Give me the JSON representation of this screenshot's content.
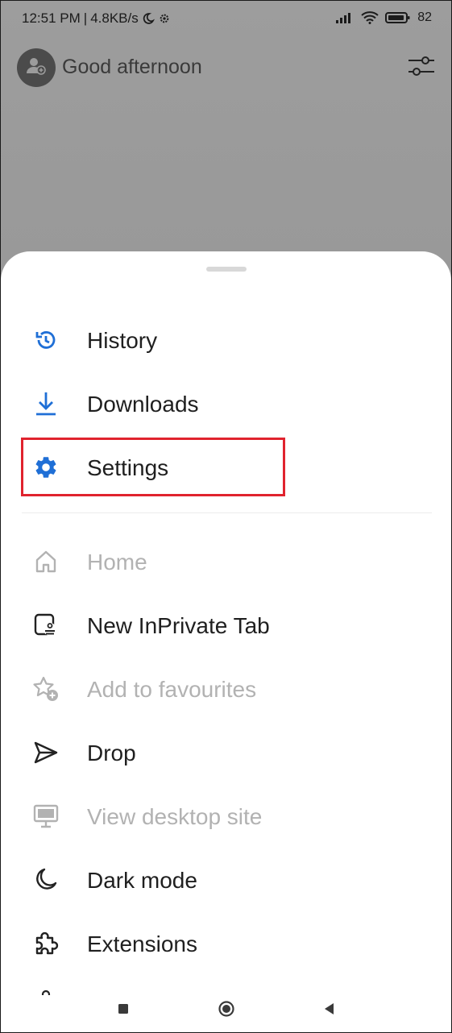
{
  "status_bar": {
    "time": "12:51 PM",
    "separator": "|",
    "speed": "4.8KB/s",
    "icons": [
      "moon-icon",
      "settings-gear-icon",
      "signal-icon",
      "wifi-icon",
      "battery-icon"
    ],
    "battery_percent": "82"
  },
  "header": {
    "greeting": "Good afternoon",
    "avatar_icon": "add-profile-icon",
    "customize_icon": "tune-sliders-icon"
  },
  "menu": {
    "primary": [
      {
        "label": "History",
        "icon": "history-icon",
        "color": "#1f6fd6",
        "enabled": true
      },
      {
        "label": "Downloads",
        "icon": "download-icon",
        "color": "#1f6fd6",
        "enabled": true
      },
      {
        "label": "Settings",
        "icon": "gear-icon",
        "color": "#1f6fd6",
        "enabled": true,
        "highlighted": true
      }
    ],
    "secondary": [
      {
        "label": "Home",
        "icon": "home-icon",
        "enabled": false
      },
      {
        "label": "New InPrivate Tab",
        "icon": "inprivate-tab-icon",
        "enabled": true
      },
      {
        "label": "Add to favourites",
        "icon": "add-favourite-icon",
        "enabled": false
      },
      {
        "label": "Drop",
        "icon": "send-icon",
        "enabled": true
      },
      {
        "label": "View desktop site",
        "icon": "desktop-icon",
        "enabled": false
      },
      {
        "label": "Dark mode",
        "icon": "moon-icon",
        "enabled": true
      },
      {
        "label": "Extensions",
        "icon": "puzzle-icon",
        "enabled": true
      }
    ]
  },
  "colors": {
    "accent": "#1f6fd6",
    "highlight_border": "#e0232e",
    "disabled_text": "#b2b2b2"
  },
  "navbar": {
    "icons": [
      "recents-square-icon",
      "home-circle-icon",
      "back-triangle-icon"
    ]
  }
}
